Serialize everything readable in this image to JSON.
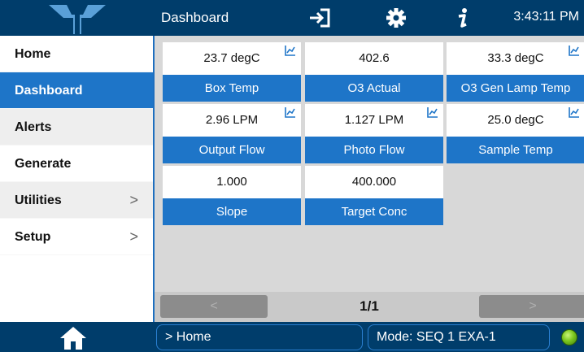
{
  "header": {
    "title": "Dashboard",
    "time": "3:43:11 PM",
    "icons": [
      "exit-icon",
      "gear-icon",
      "info-icon"
    ]
  },
  "sidebar": {
    "items": [
      {
        "label": "Home",
        "chevron": ""
      },
      {
        "label": "Dashboard",
        "chevron": ""
      },
      {
        "label": "Alerts",
        "chevron": ""
      },
      {
        "label": "Generate",
        "chevron": ""
      },
      {
        "label": "Utilities",
        "chevron": ">"
      },
      {
        "label": "Setup",
        "chevron": ">"
      }
    ],
    "active_index": 1
  },
  "tiles": [
    {
      "value": "23.7 degC",
      "name": "Box Temp",
      "graph": true
    },
    {
      "value": "402.6",
      "name": "O3 Actual",
      "graph": false
    },
    {
      "value": "33.3 degC",
      "name": "O3 Gen Lamp Temp",
      "graph": true
    },
    {
      "value": "2.96 LPM",
      "name": "Output Flow",
      "graph": true
    },
    {
      "value": "1.127 LPM",
      "name": "Photo Flow",
      "graph": true
    },
    {
      "value": "25.0 degC",
      "name": "Sample Temp",
      "graph": true
    },
    {
      "value": "1.000",
      "name": "Slope",
      "graph": false
    },
    {
      "value": "400.000",
      "name": "Target Conc",
      "graph": false
    }
  ],
  "pager": {
    "prev": "<",
    "next": ">",
    "label": "1/1"
  },
  "status": {
    "breadcrumb": "> Home",
    "mode": "Mode: SEQ 1 EXA-1",
    "indicator_color": "#7cc81e"
  },
  "colors": {
    "accent": "#1e75c8",
    "bar": "#003d6b"
  }
}
